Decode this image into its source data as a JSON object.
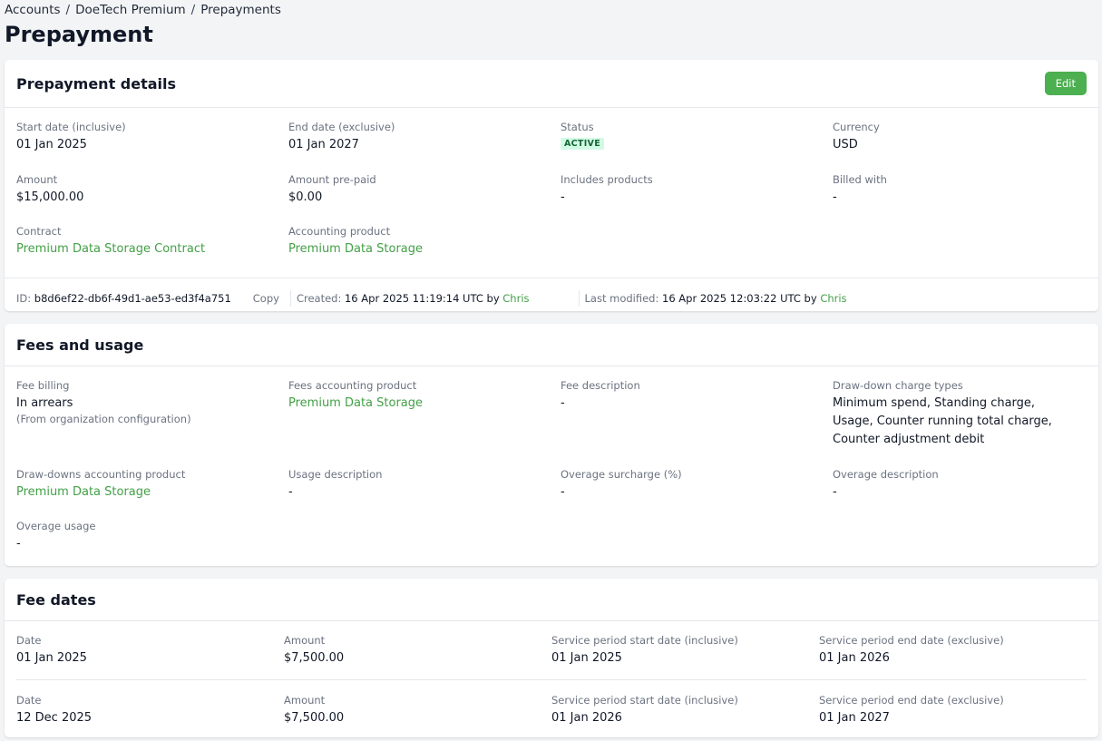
{
  "breadcrumb": [
    "Accounts",
    "DoeTech Premium",
    "Prepayments"
  ],
  "page_title": "Prepayment",
  "details": {
    "title": "Prepayment details",
    "edit_label": "Edit",
    "start_date_label": "Start date (inclusive)",
    "start_date": "01 Jan 2025",
    "end_date_label": "End date (exclusive)",
    "end_date": "01 Jan 2027",
    "status_label": "Status",
    "status": "ACTIVE",
    "currency_label": "Currency",
    "currency": "USD",
    "amount_label": "Amount",
    "amount": "$15,000.00",
    "prepaid_label": "Amount pre-paid",
    "prepaid": "$0.00",
    "includes_label": "Includes products",
    "includes": "-",
    "billed_label": "Billed with",
    "billed": "-",
    "contract_label": "Contract",
    "contract": "Premium Data Storage Contract",
    "acct_product_label": "Accounting product",
    "acct_product": "Premium Data Storage",
    "colors": {
      "accent": "#43a047",
      "edit_button": "#4caf50",
      "badge_bg": "#d1fae5"
    }
  },
  "meta": {
    "id_label": "ID:",
    "id": "b8d6ef22-db6f-49d1-ae53-ed3f4a751",
    "copy": "Copy",
    "created_label": "Created:",
    "created": "16 Apr 2025 11:19:14 UTC",
    "by": "by",
    "created_by": "Chris",
    "modified_label": "Last modified:",
    "modified": "16 Apr 2025 12:03:22 UTC",
    "modified_by": "Chris"
  },
  "fees": {
    "title": "Fees and usage",
    "fee_billing_label": "Fee billing",
    "fee_billing": "In arrears",
    "fee_billing_note": "(From organization configuration)",
    "fees_product_label": "Fees accounting product",
    "fees_product": "Premium Data Storage",
    "fee_desc_label": "Fee description",
    "fee_desc": "-",
    "drawdown_types_label": "Draw-down charge types",
    "drawdown_types": "Minimum spend, Standing charge, Usage, Counter running total charge, Counter adjustment debit",
    "drawdown_product_label": "Draw-downs accounting product",
    "drawdown_product": "Premium Data Storage",
    "usage_desc_label": "Usage description",
    "usage_desc": "-",
    "surcharge_label": "Overage surcharge (%)",
    "surcharge": "-",
    "overage_desc_label": "Overage description",
    "overage_desc": "-",
    "overage_usage_label": "Overage usage",
    "overage_usage": "-"
  },
  "fee_dates": {
    "title": "Fee dates",
    "rows": [
      {
        "date_label": "Date",
        "date": "01 Jan 2025",
        "amount_label": "Amount",
        "amount": "$7,500.00",
        "start_label": "Service period start date (inclusive)",
        "start": "01 Jan 2025",
        "end_label": "Service period end date (exclusive)",
        "end": "01 Jan 2026"
      },
      {
        "date_label": "Date",
        "date": "12 Dec 2025",
        "amount_label": "Amount",
        "amount": "$7,500.00",
        "start_label": "Service period start date (inclusive)",
        "start": "01 Jan 2026",
        "end_label": "Service period end date (exclusive)",
        "end": "01 Jan 2027"
      }
    ]
  }
}
